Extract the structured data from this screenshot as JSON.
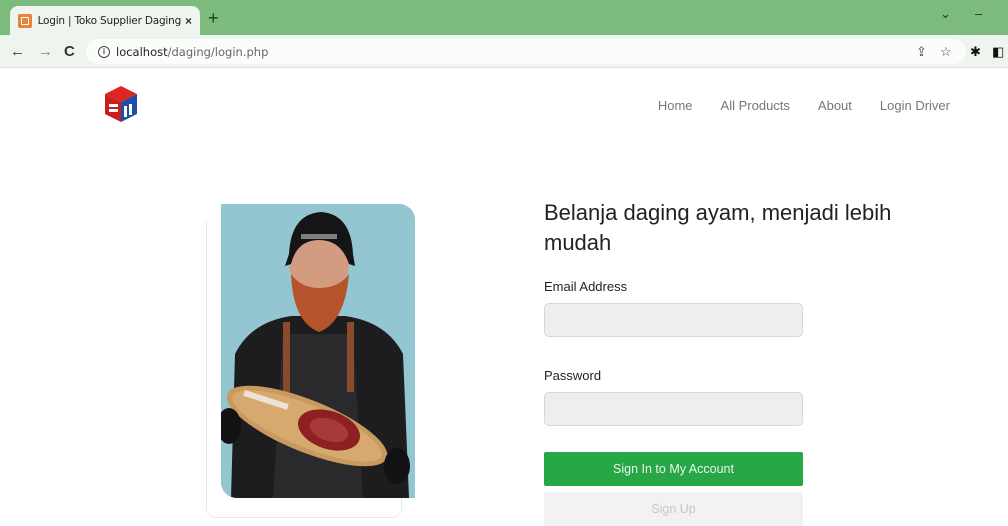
{
  "browser": {
    "tab_title": "Login | Toko Supplier Daging Ayam",
    "tab_close": "×",
    "new_tab": "+",
    "url_host": "localhost",
    "url_path": "/daging/login.php"
  },
  "nav": {
    "items": [
      {
        "label": "Home"
      },
      {
        "label": "All Products"
      },
      {
        "label": "About"
      },
      {
        "label": "Login Driver"
      }
    ]
  },
  "login": {
    "heading": "Belanja daging ayam, menjadi lebih mudah",
    "email_label": "Email Address",
    "email_value": "",
    "password_label": "Password",
    "password_value": "",
    "signin_label": "Sign In to My Account",
    "signup_label": "Sign Up"
  },
  "colors": {
    "tabbar": "#7dbb7d",
    "primary_button": "#27a745",
    "logo_red": "#e02424",
    "logo_blue": "#1e4fa3"
  }
}
